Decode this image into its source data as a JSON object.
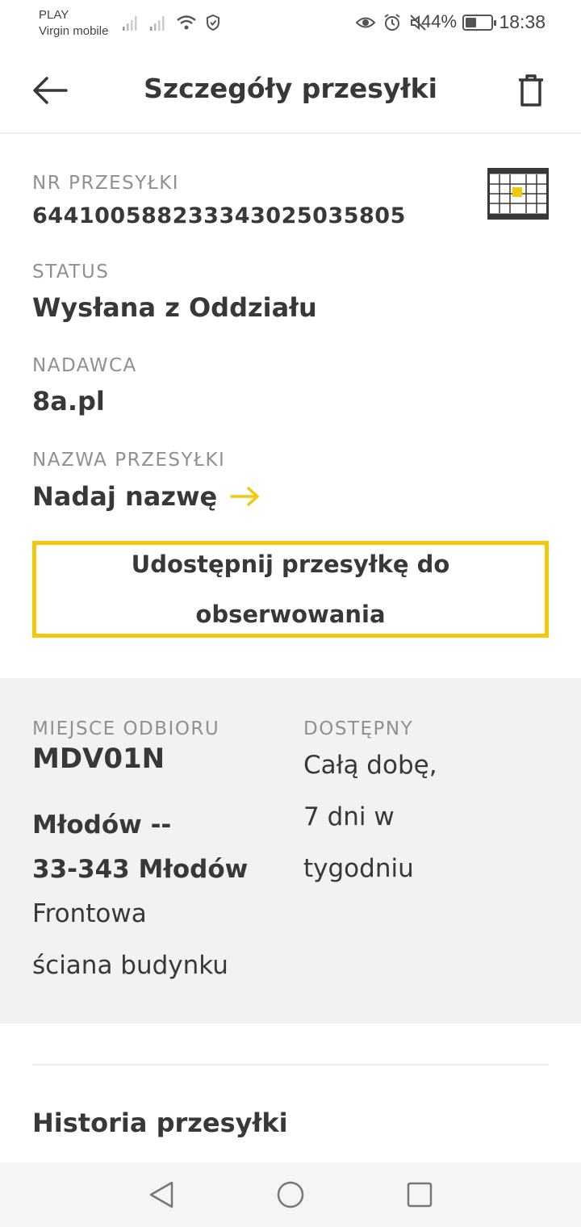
{
  "status_bar": {
    "carrier": "PLAY",
    "carrier_sub": "Virgin mobile",
    "battery_percent": "44%",
    "battery_level": 0.44,
    "time": "18:38",
    "icons": [
      "signal-icon",
      "signal-icon",
      "wifi-icon",
      "shield-icon",
      "eye-icon",
      "alarm-icon",
      "mute-icon",
      "battery-icon"
    ]
  },
  "header": {
    "title": "Szczegóły przesyłki",
    "back_icon": "arrow-left-icon",
    "delete_icon": "trash-icon"
  },
  "details": {
    "nr_label": "NR PRZESYŁKI",
    "nr_value": "644100588233343025035805",
    "status_label": "STATUS",
    "status_value": "Wysłana z Oddziału",
    "sender_label": "NADAWCA",
    "sender_value": "8a.pl",
    "name_label": "NAZWA PRZESYŁKI",
    "name_link": "Nadaj nazwę",
    "code_icon": "parcel-locker-icon"
  },
  "share_button": "Udostępnij przesyłkę do obserwowania",
  "pickup": {
    "place_label": "MIEJSCE ODBIORU",
    "place_code": "MDV01N",
    "city_line1": "Młodów --",
    "city_line2": "33-343 Młodów",
    "desc_line1": "Frontowa",
    "desc_line2": "ściana budynku",
    "available_label": "DOSTĘPNY",
    "available_line1": "Całą dobę,",
    "available_line2": "7 dni w",
    "available_line3": "tygodniu"
  },
  "history": {
    "title": "Historia przesyłki"
  },
  "colors": {
    "accent": "#f2c80f",
    "text": "#383838",
    "label": "#909090",
    "section_bg": "#f2f2f2"
  }
}
